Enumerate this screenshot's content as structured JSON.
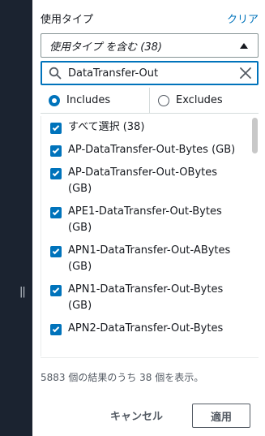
{
  "header": {
    "label": "使用タイプ",
    "clear_label": "クリア"
  },
  "filter_select": {
    "value": "使用タイプ を含む (38)",
    "icon": "caret-up-icon"
  },
  "search": {
    "value": "DataTransfer-Out",
    "icon": "search-icon",
    "clear_icon": "close-icon"
  },
  "mode": {
    "includes_label": "Includes",
    "excludes_label": "Excludes",
    "selected": "includes"
  },
  "items": [
    {
      "label": "すべて選択 (38)",
      "checked": true
    },
    {
      "label": "AP-DataTransfer-Out-Bytes (GB)",
      "checked": true
    },
    {
      "label": "AP-DataTransfer-Out-OBytes (GB)",
      "checked": true
    },
    {
      "label": "APE1-DataTransfer-Out-Bytes (GB)",
      "checked": true
    },
    {
      "label": "APN1-DataTransfer-Out-ABytes (GB)",
      "checked": true
    },
    {
      "label": "APN1-DataTransfer-Out-Bytes (GB)",
      "checked": true
    },
    {
      "label": "APN2-DataTransfer-Out-Bytes",
      "checked": true
    }
  ],
  "footer": {
    "result_text": "5883 個の結果のうち 38 個を表示。",
    "cancel_label": "キャンセル",
    "apply_label": "適用"
  },
  "colors": {
    "accent": "#0073bb",
    "sidebar_bg": "#1b2330"
  }
}
